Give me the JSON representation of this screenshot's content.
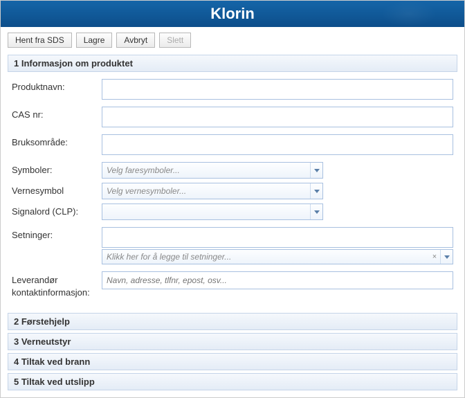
{
  "header": {
    "title": "Klorin"
  },
  "toolbar": {
    "hent_label": "Hent fra SDS",
    "lagre_label": "Lagre",
    "avbryt_label": "Avbryt",
    "slett_label": "Slett"
  },
  "sections": {
    "s1": {
      "title": "1 Informasjon om produktet"
    },
    "s2": {
      "title": "2 Førstehjelp"
    },
    "s3": {
      "title": "3 Verneutstyr"
    },
    "s4": {
      "title": "4 Tiltak ved brann"
    },
    "s5": {
      "title": "5 Tiltak ved utslipp"
    }
  },
  "fields": {
    "produktnavn": {
      "label": "Produktnavn:",
      "value": ""
    },
    "casnr": {
      "label": "CAS nr:",
      "value": ""
    },
    "bruksomrade": {
      "label": "Bruksområde:",
      "value": ""
    },
    "symboler": {
      "label": "Symboler:",
      "placeholder": "Velg faresymboler..."
    },
    "vernesymbol": {
      "label": "Vernesymbol",
      "placeholder": "Velg vernesymboler..."
    },
    "signalord": {
      "label": "Signalord (CLP):",
      "placeholder": ""
    },
    "setninger": {
      "label": "Setninger:",
      "add_placeholder": "Klikk her for å legge til setninger..."
    },
    "leverandor": {
      "label_line1": "Leverandør",
      "label_line2": "kontaktinformasjon:",
      "placeholder": "Navn, adresse, tlfnr, epost, osv..."
    }
  }
}
